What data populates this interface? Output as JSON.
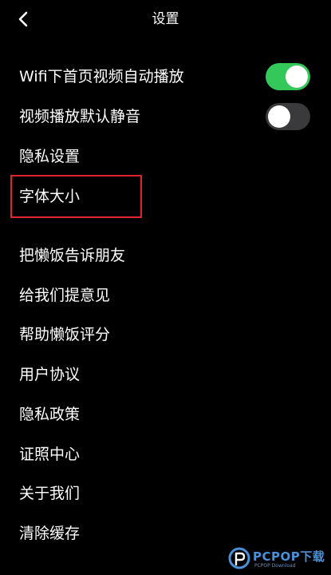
{
  "header": {
    "title": "设置",
    "back_icon": "chevron-left-icon"
  },
  "settings": [
    {
      "label": "Wifi下首页视频自动播放",
      "control": "toggle",
      "state": "on"
    },
    {
      "label": "视频播放默认静音",
      "control": "toggle",
      "state": "off"
    },
    {
      "label": "隐私设置"
    },
    {
      "label": "字体大小",
      "highlighted": true
    },
    {
      "label": "把懒饭告诉朋友"
    },
    {
      "label": "给我们提意见"
    },
    {
      "label": "帮助懒饭评分"
    },
    {
      "label": "用户协议"
    },
    {
      "label": "隐私政策"
    },
    {
      "label": "证照中心"
    },
    {
      "label": "关于我们"
    },
    {
      "label": "清除缓存"
    }
  ],
  "colors": {
    "background": "#000000",
    "text": "#ffffff",
    "toggle_on": "#34c759",
    "toggle_off": "#3a3a3c",
    "highlight_border": "#e0232e"
  },
  "watermark": {
    "text": "PCPOP下载",
    "subtext": "PCPOP Download"
  }
}
